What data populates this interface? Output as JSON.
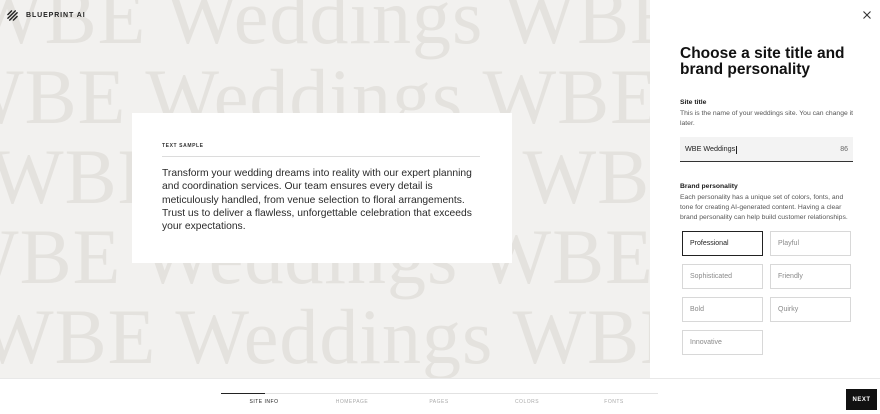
{
  "brand": {
    "name": "BLUEPRINT AI"
  },
  "preview": {
    "background_text": "WBE Weddings WBE Weddings WBE Weddings",
    "card": {
      "label": "TEXT SAMPLE",
      "body": "Transform your wedding dreams into reality with our expert planning and coordination services. Our team ensures every detail is meticulously handled, from venue selection to floral arrangements. Trust us to deliver a flawless, unforgettable celebration that exceeds your expectations."
    }
  },
  "panel": {
    "title": "Choose a site title and brand personality",
    "site_title": {
      "label": "Site title",
      "description": "This is the name of your weddings site. You can change it later.",
      "value": "WBE Weddings",
      "remaining": "86"
    },
    "personality": {
      "label": "Brand personality",
      "description": "Each personality has a unique set of colors, fonts, and tone for creating AI-generated content. Having a clear brand personality can help build customer relationships.",
      "options": [
        "Professional",
        "Playful",
        "Sophisticated",
        "Friendly",
        "Bold",
        "Quirky",
        "Innovative"
      ],
      "selected": "Professional"
    }
  },
  "footer": {
    "steps": [
      "SITE INFO",
      "HOMEPAGE",
      "PAGES",
      "COLORS",
      "FONTS"
    ],
    "active_step": "SITE INFO",
    "next_label": "NEXT"
  },
  "colors": {
    "primary": "#111111",
    "preview_bg": "#f2f1ef",
    "watermark": "#e4e2de"
  }
}
